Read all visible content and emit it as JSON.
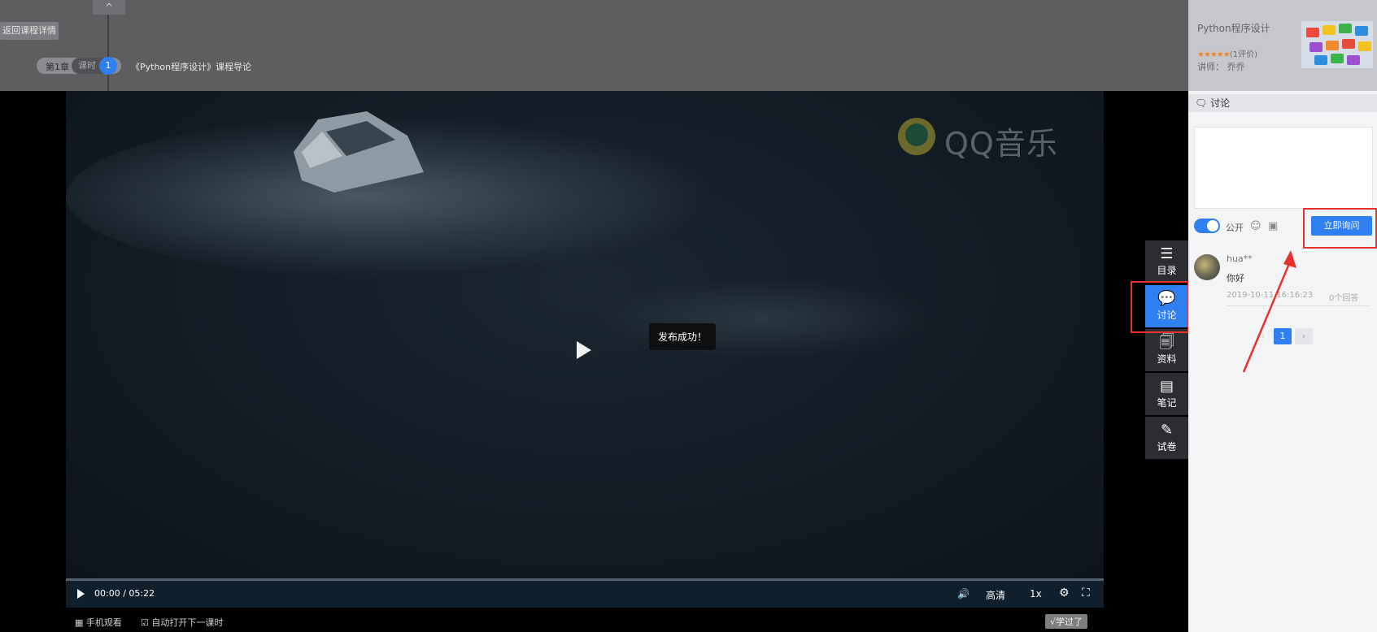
{
  "top": {
    "back_label": "返回课程详情",
    "chapter": "第1章",
    "lesson_tag": "课时",
    "lesson_number": "1",
    "lesson_title": "《Python程序设计》课程导论",
    "collapse": "^"
  },
  "video": {
    "watermark": "QQ音乐",
    "toast": "发布成功！",
    "time": "00:00 / 05:22",
    "quality": "高清",
    "speed": "1x",
    "progress": 0
  },
  "bottom": {
    "mobile": "手机观看",
    "autoplay": "自动打开下一课时",
    "learned": "√学过了"
  },
  "sidetabs": [
    {
      "label": "目录",
      "icon": "list-icon"
    },
    {
      "label": "讨论",
      "icon": "chat-icon",
      "active": true
    },
    {
      "label": "资料",
      "icon": "files-icon"
    },
    {
      "label": "笔记",
      "icon": "notes-icon"
    },
    {
      "label": "试卷",
      "icon": "pen-icon"
    }
  ],
  "course": {
    "title": "Python程序设计",
    "stars": "★★★★★",
    "reviews": "(1评价)",
    "teacher_label": "讲师：",
    "teacher_name": "乔乔"
  },
  "discussion": {
    "header": "讨论",
    "public_label": "公开",
    "public_on": true,
    "ask_button": "立即询问",
    "posts": [
      {
        "user": "hua**",
        "text": "你好",
        "date": "2019-10-11 16:16:23",
        "replies": "0个回答"
      }
    ],
    "page": "1",
    "next": "›",
    "prev": "‹"
  },
  "colors": {
    "accent": "#2f7ff0",
    "highlight": "#e8322d"
  }
}
